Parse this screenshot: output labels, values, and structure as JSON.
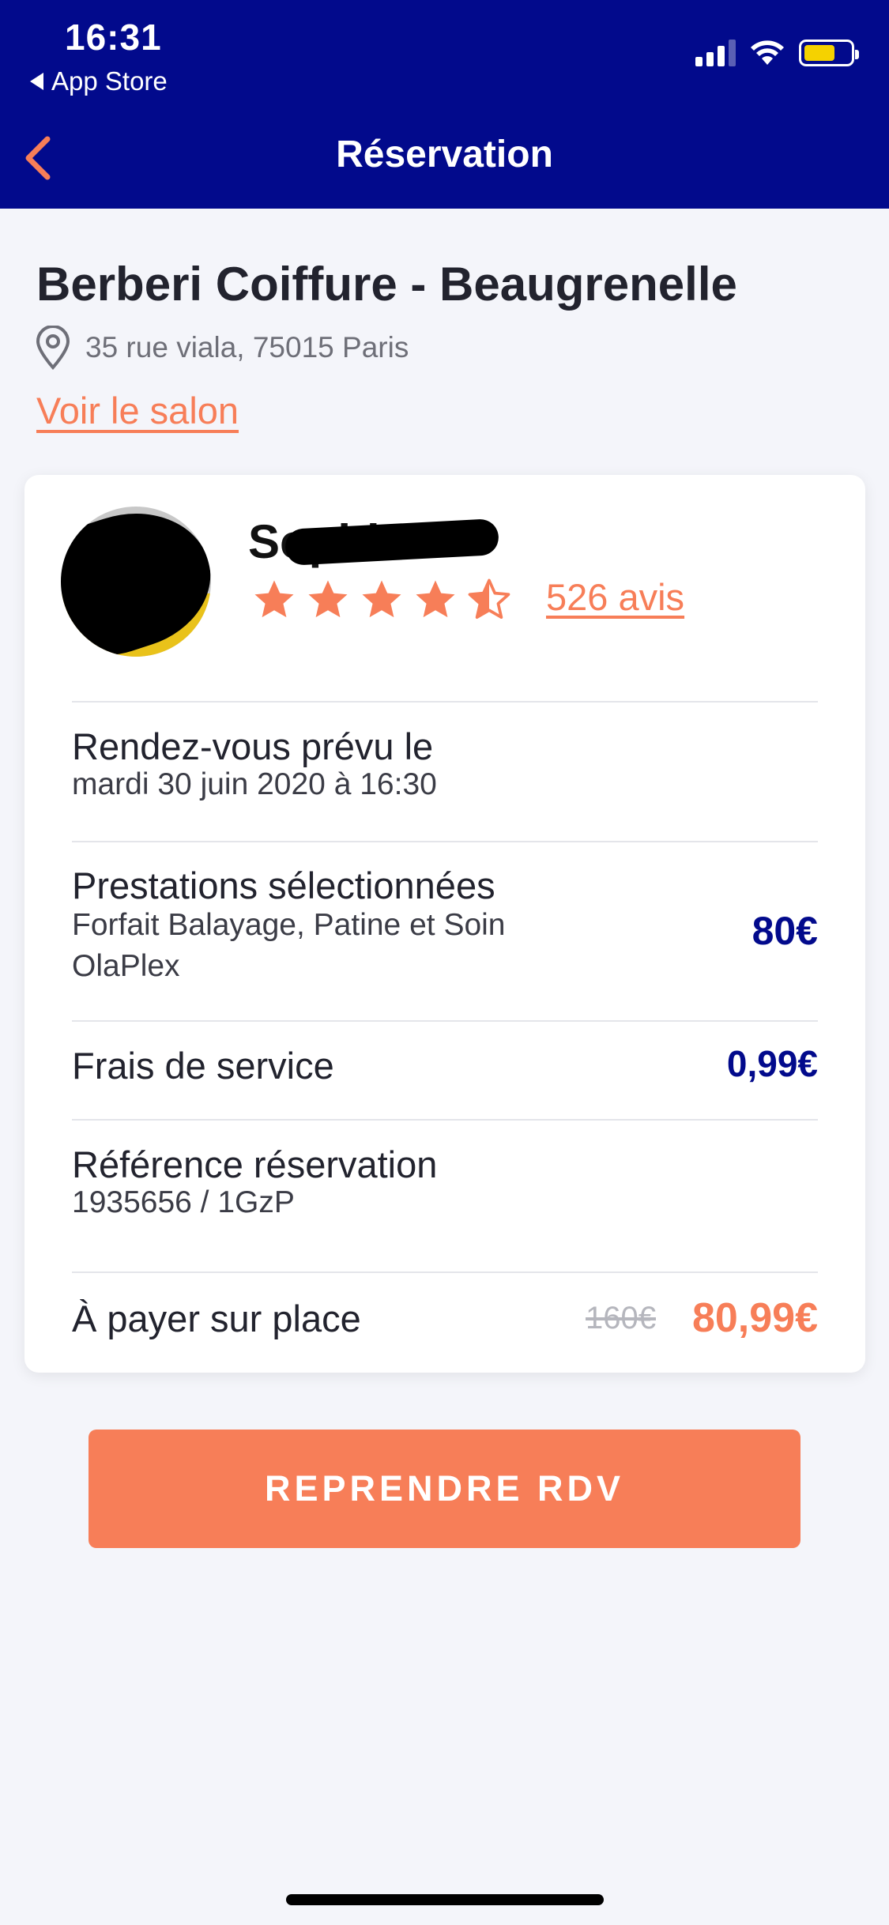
{
  "status_bar": {
    "time": "16:31",
    "back_app": "App Store",
    "battery_color": "#f5d200"
  },
  "nav": {
    "title": "Réservation",
    "back_icon": "chevron-left-icon"
  },
  "salon": {
    "name": "Berberi Coiffure - Beaugrenelle",
    "address": "35 rue viala, 75015 Paris",
    "link": "Voir le salon"
  },
  "stylist": {
    "name": "Sophie",
    "rating": 4.5,
    "reviews": "526 avis"
  },
  "appointment": {
    "title": "Rendez-vous prévu le",
    "value": "mardi 30 juin 2020 à 16:30"
  },
  "services": {
    "title": "Prestations sélectionnées",
    "line1": "Forfait Balayage, Patine et Soin",
    "line2": "OlaPlex",
    "price": "80€"
  },
  "fee": {
    "title": "Frais de service",
    "price": "0,99€"
  },
  "reference": {
    "title": "Référence réservation",
    "value": "1935656 / 1GzP"
  },
  "total": {
    "title": "À payer sur place",
    "old_price": "160€",
    "price": "80,99€"
  },
  "cta": {
    "label": "REPRENDRE RDV"
  },
  "colors": {
    "navy": "#020a8c",
    "accent": "#f77e58",
    "background": "#f4f5fa"
  }
}
